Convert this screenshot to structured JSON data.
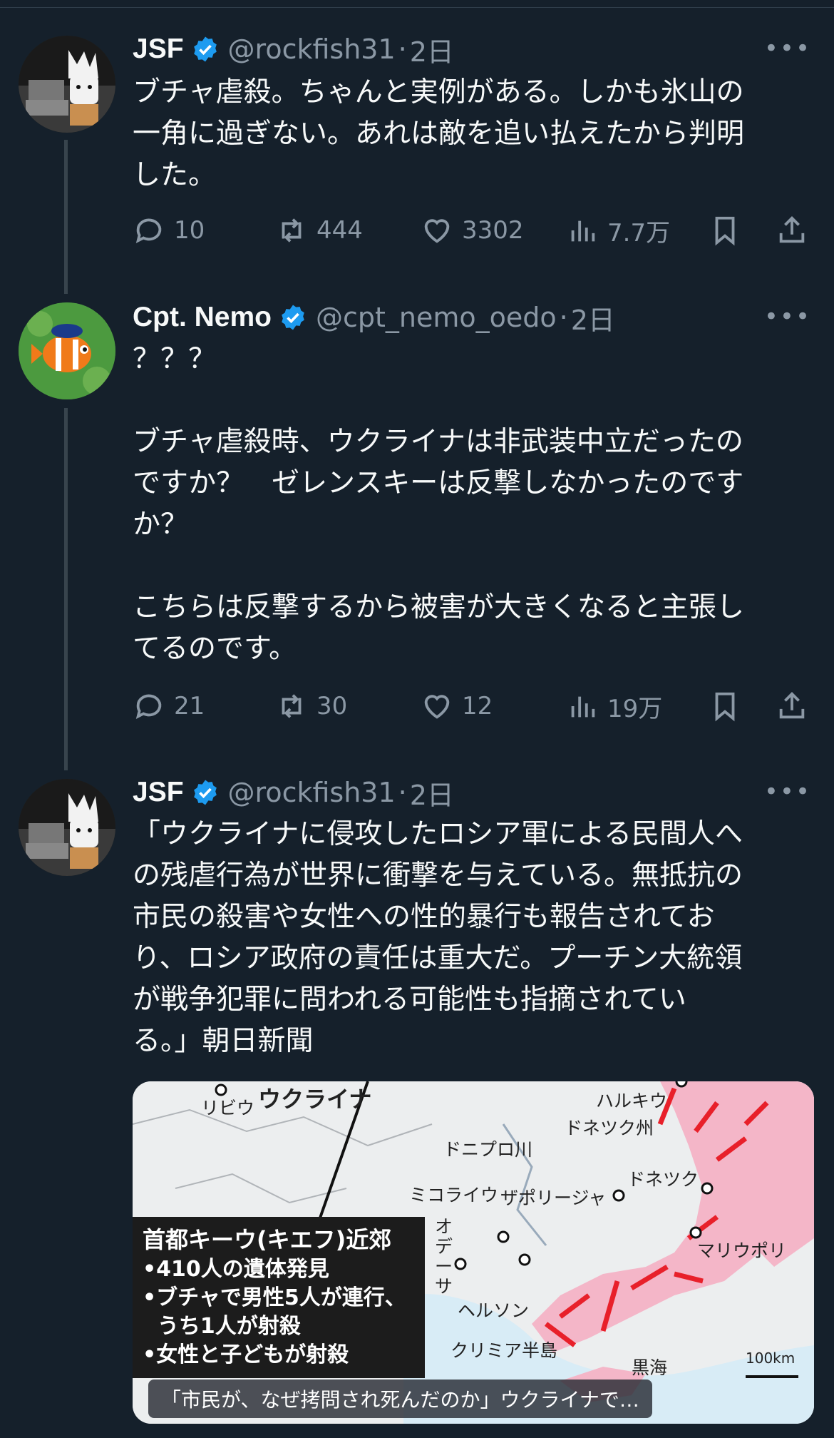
{
  "tweets": [
    {
      "author_name": "JSF",
      "handle": "@rockfish31",
      "time": "2日",
      "avatar": "toro-cat-avatar",
      "text": [
        "ブチャ虐殺。ちゃんと実例がある。しかも氷山の",
        "一角に過ぎない。あれは敵を追い払えたから判明",
        "した。"
      ],
      "replies": "10",
      "retweets": "444",
      "likes": "3302",
      "views": "7.7万"
    },
    {
      "author_name": "Cpt. Nemo",
      "handle": "@cpt_nemo_oedo",
      "time": "2日",
      "avatar": "clownfish-avatar",
      "text": [
        "？？？",
        "",
        "ブチャ虐殺時、ウクライナは非武装中立だったの",
        "ですか？　ゼレンスキーは反撃しなかったのです",
        "か？",
        "",
        "こちらは反撃するから被害が大きくなると主張し",
        "てるのです。"
      ],
      "replies": "21",
      "retweets": "30",
      "likes": "12",
      "views": "19万"
    },
    {
      "author_name": "JSF",
      "handle": "@rockfish31",
      "time": "2日",
      "avatar": "toro-cat-avatar",
      "text": [
        "「ウクライナに侵攻したロシア軍による民間人へ",
        "の残虐行為が世界に衝撃を与えている。無抵抗の",
        "市民の殺害や女性への性的暴行も報告されてお",
        "り、ロシア政府の責任は重大だ。プーチン大統領",
        "が戦争犯罪に問われる可能性も指摘されてい",
        "る。」朝日新聞"
      ]
    }
  ],
  "separator": "·",
  "verified_icon": "verified-badge-icon",
  "colors": {
    "background": "#15202b",
    "muted": "#8b98a5",
    "verified": "#1d9bf0",
    "occupied": "#f4b6c8",
    "arrow": "#e8202a"
  },
  "link_card": {
    "caption": "「市民が、なぜ拷問され死んだのか」ウクライナで…",
    "map": {
      "labels": {
        "lviv": "リビウ",
        "ukraine": "ウクライナ",
        "kharkiv": "ハルキウ",
        "donetsk_oblast": "ドネツク州",
        "dnipro": "ドニプロ川",
        "donetsk": "ドネツク",
        "mykolaiv": "ミコライウ",
        "zaporizhzhia": "ザポリージャ",
        "odesa": "オデーサ",
        "mariupol": "マリウポリ",
        "kherson": "ヘルソン",
        "crimea": "クリミア半島",
        "black_sea": "黒海",
        "scale": "100km"
      },
      "legend": {
        "title": "首都キーウ(キエフ)近郊",
        "items": [
          "•410人の遺体発見",
          "•ブチャで男性5人が連行、",
          "  うち1人が射殺",
          "•女性と子どもが射殺"
        ]
      }
    }
  }
}
